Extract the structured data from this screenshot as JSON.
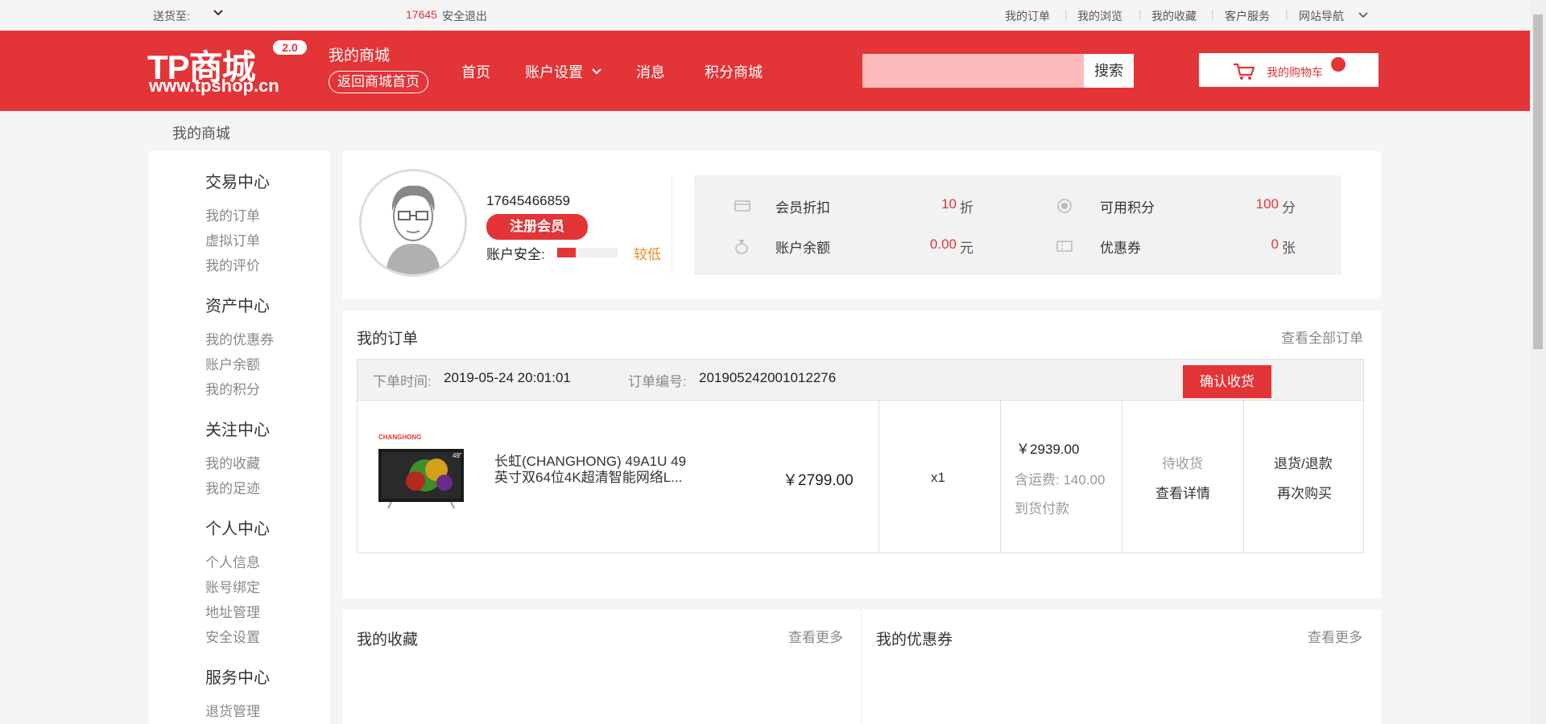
{
  "topbar": {
    "ship_label": "送货至:",
    "user_phone": "17645",
    "logout": "安全退出",
    "links": [
      "我的订单",
      "我的浏览",
      "我的收藏",
      "客户服务",
      "网站导航"
    ]
  },
  "header": {
    "logo_text": "TP商城",
    "logo_version": "2.0",
    "logo_url": "www.tpshop.cn",
    "my_mall": "我的商城",
    "back_home": "返回商城首页",
    "nav": [
      "首页",
      "账户设置",
      "消息",
      "积分商城"
    ],
    "search_placeholder": "",
    "search_button": "搜索",
    "cart_label": "我的购物车"
  },
  "breadcrumb": "我的商城",
  "sidebar": {
    "sections": [
      {
        "title": "交易中心",
        "items": [
          "我的订单",
          "虚拟订单",
          "我的评价"
        ]
      },
      {
        "title": "资产中心",
        "items": [
          "我的优惠券",
          "账户余额",
          "我的积分"
        ]
      },
      {
        "title": "关注中心",
        "items": [
          "我的收藏",
          "我的足迹"
        ]
      },
      {
        "title": "个人中心",
        "items": [
          "个人信息",
          "账号绑定",
          "地址管理",
          "安全设置"
        ]
      },
      {
        "title": "服务中心",
        "items": [
          "退货管理"
        ]
      }
    ]
  },
  "profile": {
    "phone": "17645466859",
    "member_button": "注册会员",
    "security_label": "账户安全:",
    "security_level": "较低",
    "security_fill": 0.3
  },
  "stats": {
    "discount_label": "会员折扣",
    "discount_value": "10",
    "discount_unit": "折",
    "points_label": "可用积分",
    "points_value": "100",
    "points_unit": "分",
    "balance_label": "账户余额",
    "balance_value": "0.00",
    "balance_unit": "元",
    "coupon_label": "优惠券",
    "coupon_value": "0",
    "coupon_unit": "张"
  },
  "orders": {
    "title": "我的订单",
    "view_all": "查看全部订单",
    "order_time_label": "下单时间:",
    "order_time": "2019-05-24 20:01:01",
    "order_no_label": "订单编号:",
    "order_no": "201905242001012276",
    "confirm_button": "确认收货",
    "item": {
      "name": "长虹(CHANGHONG) 49A1U 49英寸双64位4K超清智能网络L...",
      "image_brand": "CHANGHONG",
      "image_size": "49\"",
      "price": "￥2799.00",
      "qty": "x1",
      "total": "￥2939.00",
      "freight_label": "含运费:",
      "freight": "140.00",
      "pay_type": "到货付款",
      "status": "待收货",
      "detail_link": "查看详情",
      "refund_link": "退货/退款",
      "rebuy_link": "再次购买"
    }
  },
  "favorites": {
    "title": "我的收藏",
    "more": "查看更多"
  },
  "coupons": {
    "title": "我的优惠券",
    "more": "查看更多"
  },
  "colors": {
    "brand": "#e33438",
    "warning": "#f08a24"
  }
}
